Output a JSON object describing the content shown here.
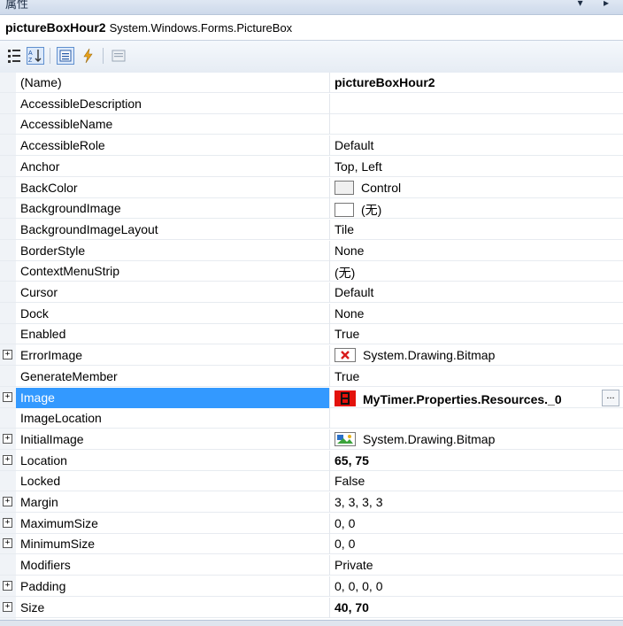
{
  "panel": {
    "title": "属性",
    "title_controls": "▾ ▸"
  },
  "object_selector": {
    "name": "pictureBoxHour2",
    "type": "System.Windows.Forms.PictureBox"
  },
  "toolbar": {
    "buttons": [
      {
        "icon": "categorized-icon",
        "active": false
      },
      {
        "icon": "alphabetical-icon",
        "active": true
      },
      {
        "icon": "properties-icon",
        "active": true
      },
      {
        "icon": "events-icon",
        "active": false
      },
      {
        "icon": "property-pages-icon",
        "active": false
      }
    ]
  },
  "properties": [
    {
      "name": "(Name)",
      "value": "pictureBoxHour2",
      "bold": true,
      "expandable": false
    },
    {
      "name": "AccessibleDescription",
      "value": "",
      "bold": false,
      "expandable": false
    },
    {
      "name": "AccessibleName",
      "value": "",
      "bold": false,
      "expandable": false
    },
    {
      "name": "AccessibleRole",
      "value": "Default",
      "bold": false,
      "expandable": false
    },
    {
      "name": "Anchor",
      "value": "Top, Left",
      "bold": false,
      "expandable": false
    },
    {
      "name": "BackColor",
      "value": "Control",
      "bold": false,
      "expandable": false,
      "swatch": "#f0f0f0"
    },
    {
      "name": "BackgroundImage",
      "value": "(无)",
      "bold": false,
      "expandable": false,
      "swatch": "#ffffff"
    },
    {
      "name": "BackgroundImageLayout",
      "value": "Tile",
      "bold": false,
      "expandable": false
    },
    {
      "name": "BorderStyle",
      "value": "None",
      "bold": false,
      "expandable": false
    },
    {
      "name": "ContextMenuStrip",
      "value": "(无)",
      "bold": false,
      "expandable": false
    },
    {
      "name": "Cursor",
      "value": "Default",
      "bold": false,
      "expandable": false
    },
    {
      "name": "Dock",
      "value": "None",
      "bold": false,
      "expandable": false
    },
    {
      "name": "Enabled",
      "value": "True",
      "bold": false,
      "expandable": false
    },
    {
      "name": "ErrorImage",
      "value": "System.Drawing.Bitmap",
      "bold": false,
      "expandable": true,
      "icon": "error-image-icon"
    },
    {
      "name": "GenerateMember",
      "value": "True",
      "bold": false,
      "expandable": false
    },
    {
      "name": "Image",
      "value": "MyTimer.Properties.Resources._0",
      "bold": true,
      "expandable": true,
      "selected": true,
      "icon": "resource-image-icon"
    },
    {
      "name": "ImageLocation",
      "value": "",
      "bold": false,
      "expandable": false
    },
    {
      "name": "InitialImage",
      "value": "System.Drawing.Bitmap",
      "bold": false,
      "expandable": true,
      "icon": "initial-image-icon"
    },
    {
      "name": "Location",
      "value": "65, 75",
      "bold": true,
      "expandable": true
    },
    {
      "name": "Locked",
      "value": "False",
      "bold": false,
      "expandable": false
    },
    {
      "name": "Margin",
      "value": "3, 3, 3, 3",
      "bold": false,
      "expandable": true
    },
    {
      "name": "MaximumSize",
      "value": "0, 0",
      "bold": false,
      "expandable": true
    },
    {
      "name": "MinimumSize",
      "value": "0, 0",
      "bold": false,
      "expandable": true
    },
    {
      "name": "Modifiers",
      "value": "Private",
      "bold": false,
      "expandable": false
    },
    {
      "name": "Padding",
      "value": "0, 0, 0, 0",
      "bold": false,
      "expandable": true
    },
    {
      "name": "Size",
      "value": "40, 70",
      "bold": true,
      "expandable": true
    }
  ],
  "ellipsis_label": "...",
  "expand_glyph": "+",
  "colors": {
    "selection": "#3399ff",
    "gutter": "#f0f3f7"
  }
}
